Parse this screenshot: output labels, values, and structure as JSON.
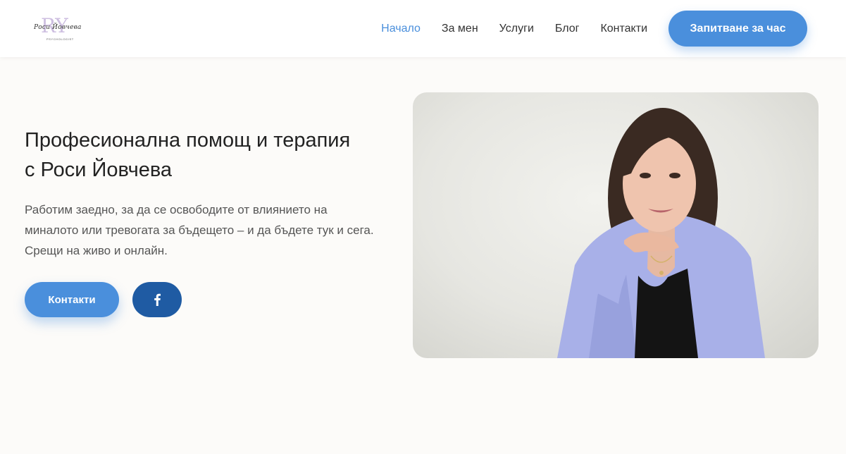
{
  "brand": {
    "monogram": "RY",
    "signature": "Роси Йовчева",
    "subtitle": "PSYCHOLOGIST"
  },
  "nav": {
    "items": [
      {
        "label": "Начало",
        "active": true
      },
      {
        "label": "За мен",
        "active": false
      },
      {
        "label": "Услуги",
        "active": false
      },
      {
        "label": "Блог",
        "active": false
      },
      {
        "label": "Контакти",
        "active": false
      }
    ],
    "cta_label": "Запитване за час"
  },
  "hero": {
    "title": "Професионална помощ и терапия с Роси Йовчева",
    "text": "Работим заедно, за да се освободите от влиянието на миналото или тревогата за бъдещето – и да бъдете тук и сега. Срещи на живо и онлайн.",
    "contacts_label": "Контакти",
    "facebook_icon": "facebook-icon"
  },
  "colors": {
    "accent": "#4a8fdc",
    "facebook": "#1f5ba3",
    "blazer": "#a8b0e8",
    "background": "#fcfbf9"
  }
}
